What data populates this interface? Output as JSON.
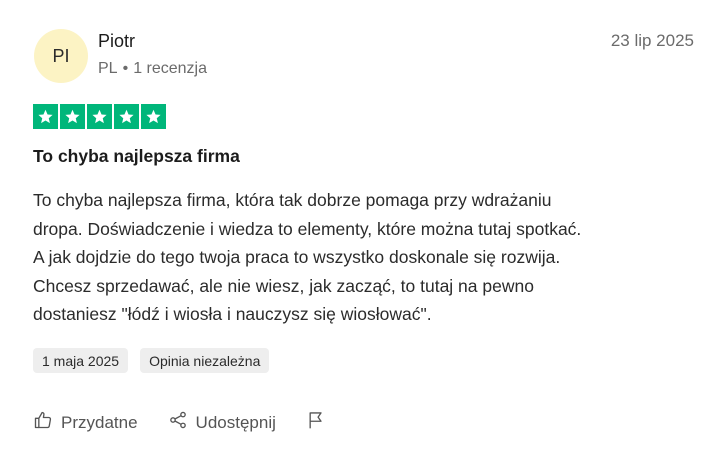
{
  "reviewer": {
    "initials": "PI",
    "name": "Piotr",
    "country": "PL",
    "separator": "•",
    "reviews_count": "1 recenzja"
  },
  "review": {
    "date": "23 lip 2025",
    "rating": 5,
    "title": "To chyba najlepsza firma",
    "body_lines": [
      "To chyba najlepsza firma, która tak dobrze pomaga przy wdrażaniu",
      "dropa. Doświadczenie i wiedza to elementy, które można tutaj spotkać.",
      "A jak dojdzie do tego twoja praca to wszystko doskonale się rozwija.",
      "Chcesz sprzedawać, ale nie wiesz, jak zacząć, to tutaj na pewno",
      "dostaniesz \"łódź i wiosła i nauczysz się wiosłować\"."
    ],
    "tags": [
      "1 maja 2025",
      "Opinia niezależna"
    ]
  },
  "actions": {
    "useful_label": "Przydatne",
    "share_label": "Udostępnij"
  },
  "colors": {
    "star_green": "#00b67a",
    "avatar_bg": "#fcf3c4",
    "tag_bg": "#eeeeee"
  }
}
